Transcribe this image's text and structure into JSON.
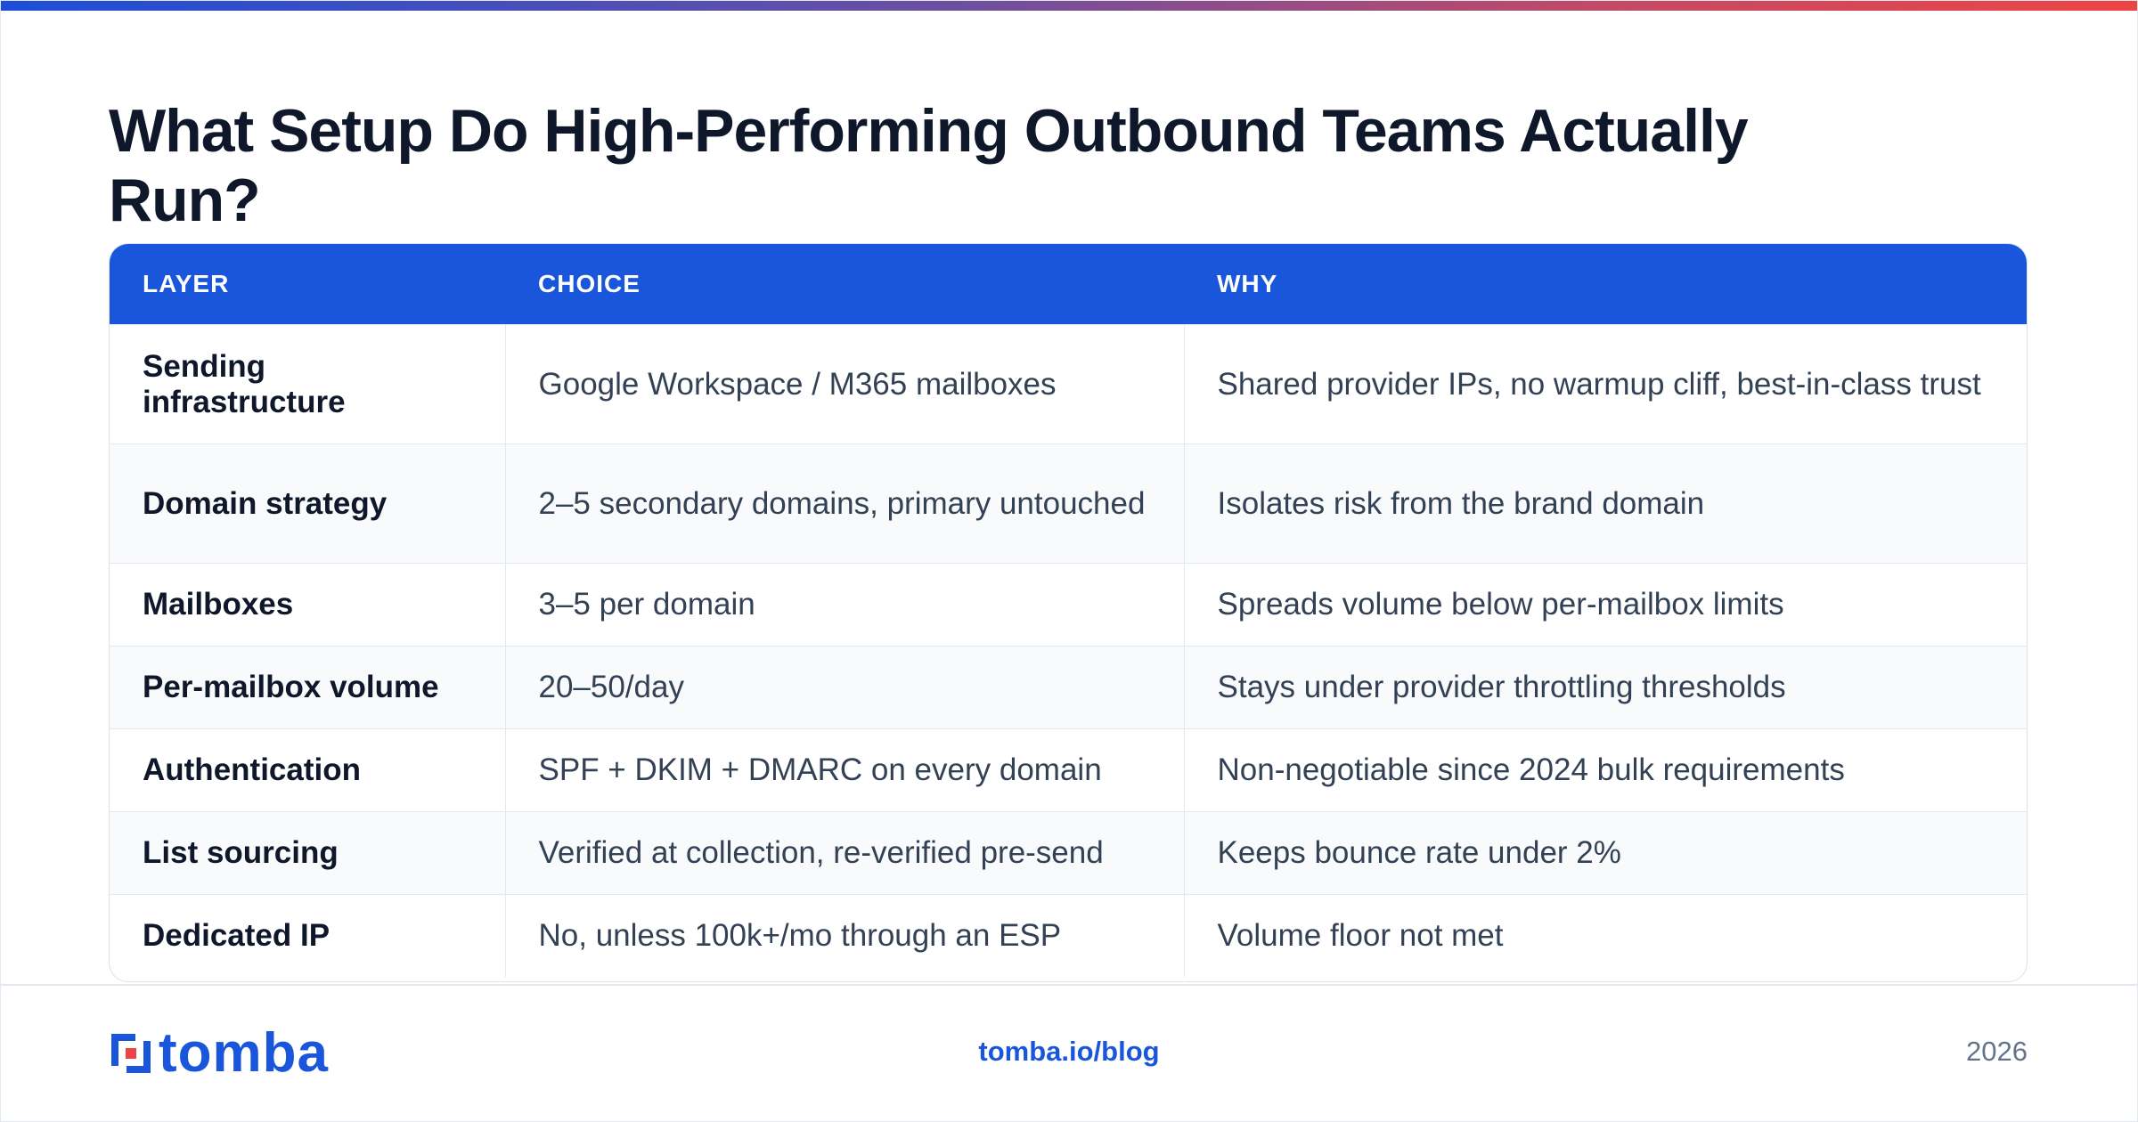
{
  "title": "What Setup Do High-Performing Outbound Teams Actually Run?",
  "table": {
    "headers": [
      "LAYER",
      "CHOICE",
      "WHY"
    ],
    "rows": [
      {
        "layer": "Sending infrastructure",
        "choice": "Google Workspace / M365 mailboxes",
        "why": "Shared provider IPs, no warmup cliff, best-in-class trust"
      },
      {
        "layer": "Domain strategy",
        "choice": "2–5 secondary domains, primary untouched",
        "why": "Isolates risk from the brand domain"
      },
      {
        "layer": "Mailboxes",
        "choice": "3–5 per domain",
        "why": "Spreads volume below per-mailbox limits"
      },
      {
        "layer": "Per-mailbox volume",
        "choice": "20–50/day",
        "why": "Stays under provider throttling thresholds"
      },
      {
        "layer": "Authentication",
        "choice": "SPF + DKIM + DMARC on every domain",
        "why": "Non-negotiable since 2024 bulk requirements"
      },
      {
        "layer": "List sourcing",
        "choice": "Verified at collection, re-verified pre-send",
        "why": "Keeps bounce rate under 2%"
      },
      {
        "layer": "Dedicated IP",
        "choice": "No, unless 100k+/mo through an ESP",
        "why": "Volume floor not met"
      }
    ]
  },
  "footer": {
    "logo_text": "tomba",
    "logo_icon": "tomba-logo-icon",
    "link": "tomba.io/blog",
    "year": "2026"
  },
  "colors": {
    "accent": "#1a56db",
    "header_bg": "#1a56db",
    "text_dark": "#0f172a",
    "text_body": "#334155",
    "muted": "#64748b"
  }
}
